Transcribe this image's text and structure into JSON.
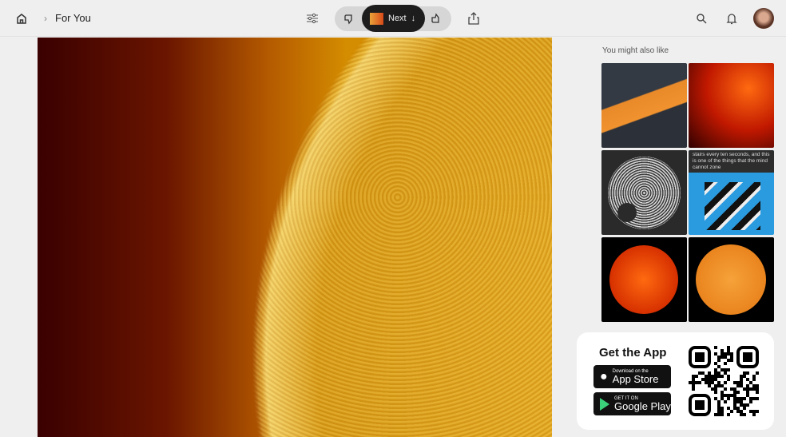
{
  "header": {
    "breadcrumb": "For You",
    "next_label": "Next",
    "icons": [
      "home-icon",
      "chevron-right-icon",
      "filter-icon",
      "thumbs-down-icon",
      "thumbs-up-icon",
      "share-icon",
      "search-icon",
      "bell-icon"
    ]
  },
  "sidebar": {
    "title": "You might also like",
    "tiles": [
      {
        "name": "orange-dune-pin"
      },
      {
        "name": "solar-flare-pin"
      },
      {
        "name": "maze-circle-pin"
      },
      {
        "name": "stairs-illusion-pin",
        "caption": "stairs every ten seconds, and this is one of the things that the mind cannot zone"
      },
      {
        "name": "red-sun-pin"
      },
      {
        "name": "orange-sun-pin"
      }
    ]
  },
  "app_card": {
    "title": "Get the App",
    "app_store_small": "Download on the",
    "app_store": "App Store",
    "google_small": "GET IT ON",
    "google": "Google Play"
  }
}
